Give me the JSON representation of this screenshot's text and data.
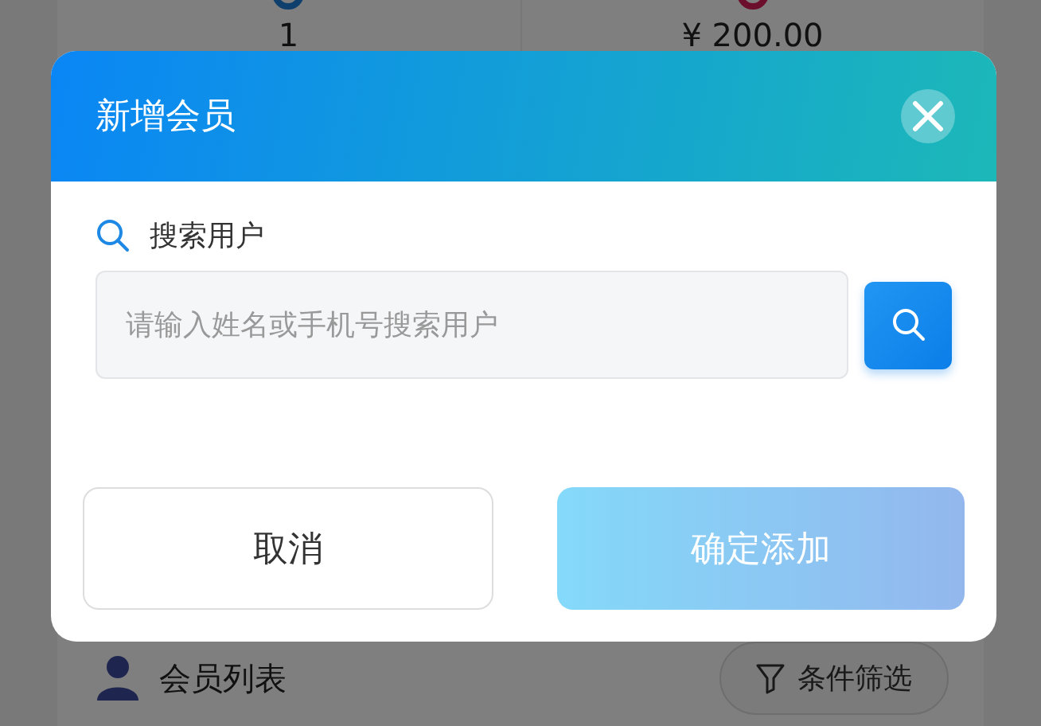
{
  "background": {
    "stats": [
      {
        "value": "1"
      },
      {
        "value": "¥ 200.00"
      }
    ],
    "section_title": "会员列表",
    "filter_button": "条件筛选"
  },
  "dialog": {
    "title": "新增会员",
    "search_label": "搜索用户",
    "search_field": {
      "placeholder": "请输入姓名或手机号搜索用户"
    },
    "buttons": [
      {
        "label": "取消",
        "kind": "cancel",
        "disabled": false
      },
      {
        "label": "确定添加",
        "kind": "confirm",
        "disabled": true
      }
    ]
  }
}
